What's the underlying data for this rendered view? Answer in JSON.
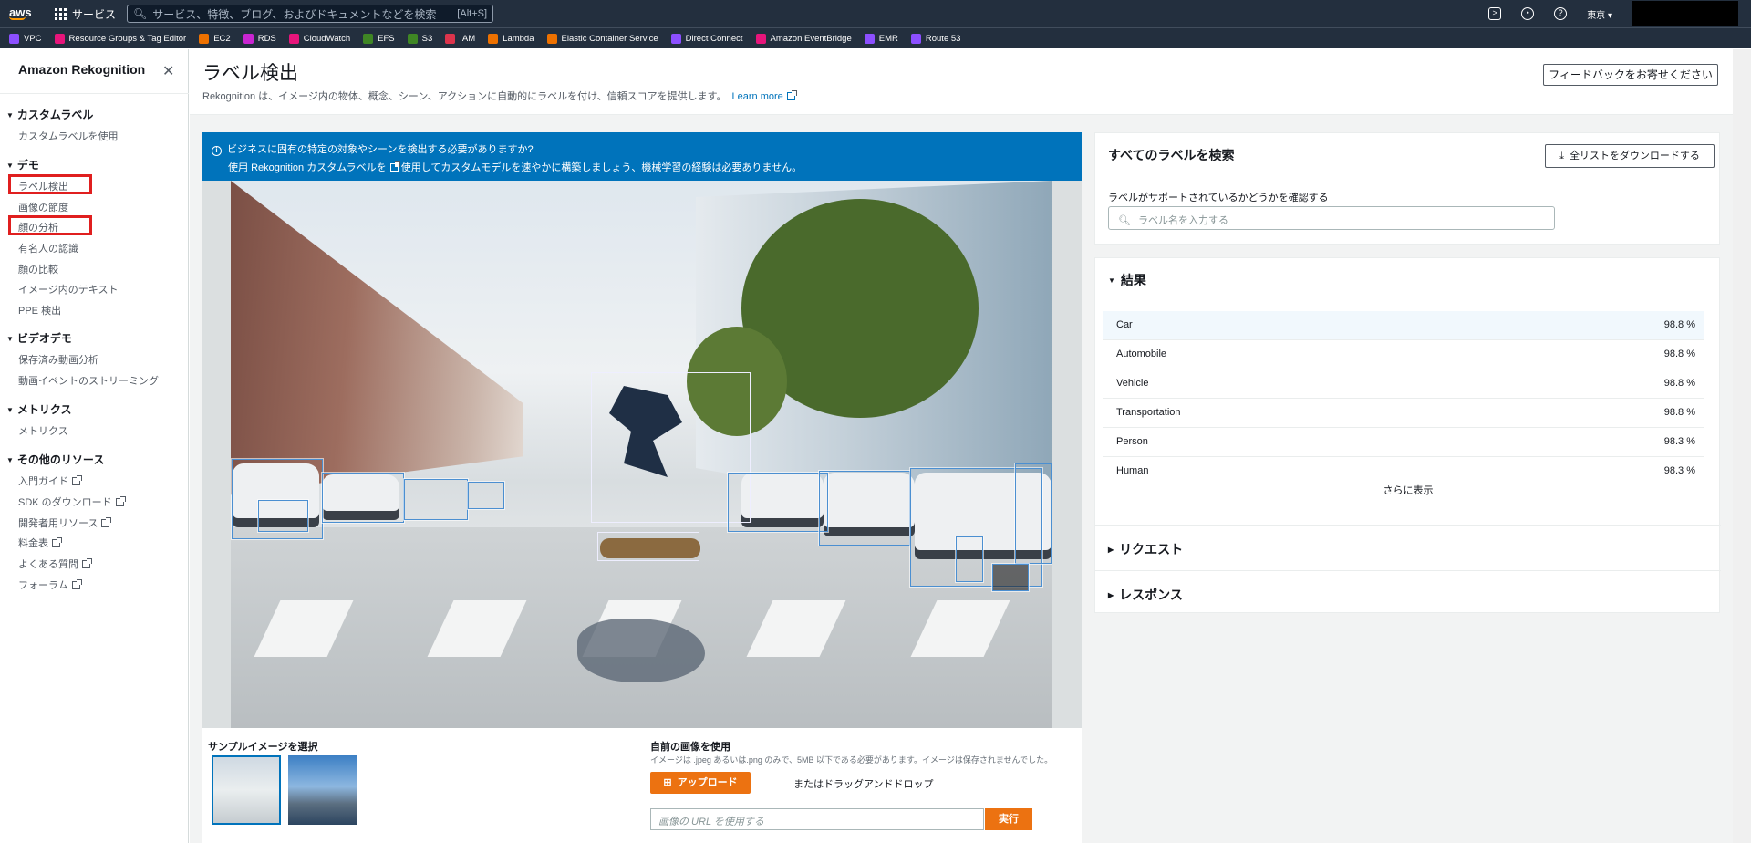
{
  "topnav": {
    "logo": "aws",
    "services_label": "サービス",
    "search_placeholder": "サービス、特徴、ブログ、およびドキュメントなどを検索",
    "search_shortcut": "[Alt+S]",
    "region": "東京 ▾"
  },
  "favorites": [
    {
      "label": "VPC",
      "color": "#8c4fff"
    },
    {
      "label": "Resource Groups & Tag Editor",
      "color": "#e7157b"
    },
    {
      "label": "EC2",
      "color": "#ed7100"
    },
    {
      "label": "RDS",
      "color": "#c925d1"
    },
    {
      "label": "CloudWatch",
      "color": "#e7157b"
    },
    {
      "label": "EFS",
      "color": "#3f8624"
    },
    {
      "label": "S3",
      "color": "#3f8624"
    },
    {
      "label": "IAM",
      "color": "#dd344c"
    },
    {
      "label": "Lambda",
      "color": "#ed7100"
    },
    {
      "label": "Elastic Container Service",
      "color": "#ed7100"
    },
    {
      "label": "Direct Connect",
      "color": "#8c4fff"
    },
    {
      "label": "Amazon EventBridge",
      "color": "#e7157b"
    },
    {
      "label": "EMR",
      "color": "#8c4fff"
    },
    {
      "label": "Route 53",
      "color": "#8c4fff"
    }
  ],
  "sidebar": {
    "title": "Amazon Rekognition",
    "sections": {
      "custom": "カスタムラベル",
      "demo": "デモ",
      "video": "ビデオデモ",
      "metrics": "メトリクス",
      "other": "その他のリソース"
    },
    "items": {
      "custom_use": "カスタムラベルを使用",
      "label_detect": "ラベル検出",
      "moderation": "画像の節度",
      "face_analysis": "顔の分析",
      "celebrity": "有名人の認識",
      "face_compare": "顔の比較",
      "text": "イメージ内のテキスト",
      "ppe": "PPE 検出",
      "stored_video": "保存済み動画分析",
      "streaming": "動画イベントのストリーミング",
      "metrics": "メトリクス",
      "getting_started": "入門ガイド",
      "sdk": "SDK のダウンロード",
      "developer": "開発者用リソース",
      "pricing": "料金表",
      "faq": "よくある質問",
      "forum": "フォーラム"
    }
  },
  "header": {
    "title": "ラベル検出",
    "description": "Rekognition は、イメージ内の物体、概念、シーン、アクションに自動的にラベルを付け、信頼スコアを提供します。",
    "learn_more": "Learn more",
    "feedback": "フィードバックをお寄せください"
  },
  "banner": {
    "line1": "ビジネスに固有の特定の対象やシーンを検出する必要がありますか?",
    "line2_pre": "使用",
    "line2_link": "Rekognition カスタムラベルを",
    "line2_post": "使用してカスタムモデルを速やかに構築しましょう、機械学習の経験は必要ありません。"
  },
  "samples": {
    "title": "サンプルイメージを選択"
  },
  "own_image": {
    "title": "自前の画像を使用",
    "desc": "イメージは .jpeg あるいは.png のみで、5MB 以下である必要があります。イメージは保存されませんでした。",
    "upload": "アップロード",
    "drag": "またはドラッグアンドドロップ",
    "url_placeholder": "画像の URL を使用する",
    "run": "実行"
  },
  "labels_panel": {
    "title": "すべてのラベルを検索",
    "download": "全リストをダウンロードする",
    "question": "ラベルがサポートされているかどうかを確認する",
    "search_placeholder": "ラベル名を入力する"
  },
  "results": {
    "title": "結果",
    "rows": [
      {
        "label": "Car",
        "pct": "98.8 %"
      },
      {
        "label": "Automobile",
        "pct": "98.8 %"
      },
      {
        "label": "Vehicle",
        "pct": "98.8 %"
      },
      {
        "label": "Transportation",
        "pct": "98.8 %"
      },
      {
        "label": "Person",
        "pct": "98.3 %"
      },
      {
        "label": "Human",
        "pct": "98.3 %"
      }
    ],
    "more": "さらに表示",
    "request": "リクエスト",
    "response": "レスポンス"
  }
}
